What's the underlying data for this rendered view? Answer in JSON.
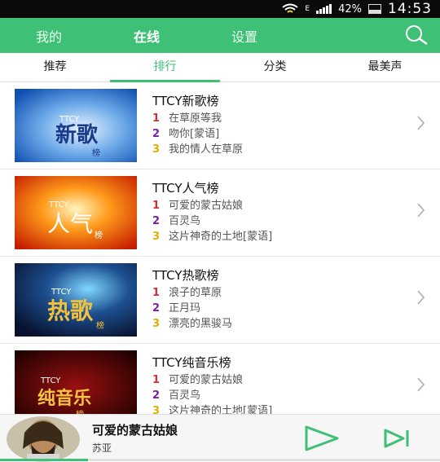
{
  "status_bar": {
    "network": "E",
    "battery": "42%",
    "battery_level": 0.42,
    "time": "14:53"
  },
  "top_nav": {
    "tabs": [
      "我的",
      "在线",
      "设置"
    ],
    "active": "在线"
  },
  "sub_tabs": {
    "tabs": [
      "推荐",
      "排行",
      "分类",
      "最美声"
    ],
    "active": "排行"
  },
  "charts": [
    {
      "title": "TTCY新歌榜",
      "cover_text": "新歌",
      "cover_small": "榜",
      "entries": [
        {
          "rank": "1",
          "name": "在草原等我"
        },
        {
          "rank": "2",
          "name": "吻你[蒙语]"
        },
        {
          "rank": "3",
          "name": "我的情人在草原"
        }
      ]
    },
    {
      "title": "TTCY人气榜",
      "cover_text": "人气",
      "cover_small": "榜",
      "entries": [
        {
          "rank": "1",
          "name": "可爱的蒙古姑娘"
        },
        {
          "rank": "2",
          "name": "百灵鸟"
        },
        {
          "rank": "3",
          "name": "这片神奇的土地[蒙语]"
        }
      ]
    },
    {
      "title": "TTCY热歌榜",
      "cover_text": "热歌",
      "cover_small": "榜",
      "entries": [
        {
          "rank": "1",
          "name": "浪子的草原"
        },
        {
          "rank": "2",
          "name": "正月玛"
        },
        {
          "rank": "3",
          "name": "漂亮的黑骏马"
        }
      ]
    },
    {
      "title": "TTCY纯音乐榜",
      "cover_text": "纯音乐",
      "cover_small": "榜",
      "entries": [
        {
          "rank": "1",
          "name": "可爱的蒙古姑娘"
        },
        {
          "rank": "2",
          "name": "百灵鸟"
        },
        {
          "rank": "3",
          "name": "这片神奇的土地[蒙语]"
        }
      ]
    }
  ],
  "cover_brand": "TTCY",
  "player": {
    "song": "可爱的蒙古姑娘",
    "artist": "苏亚",
    "progress": 0.2
  },
  "colors": {
    "accent": "#3fc077",
    "rank1": "#d32f2f",
    "rank2": "#7b1fa2",
    "rank3": "#e0b000"
  },
  "icons": {
    "search": "search-icon",
    "chevron": "chevron-right-icon",
    "play": "play-icon",
    "next": "skip-next-icon"
  }
}
